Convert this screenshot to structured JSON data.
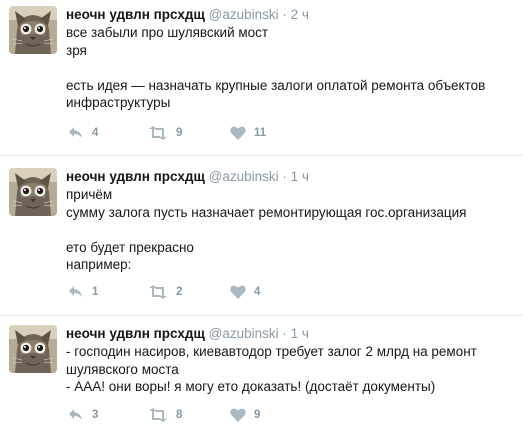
{
  "tweets": [
    {
      "author_name": "неочн удвлн прсхдщ",
      "handle": "@azubinski",
      "separator": "·",
      "time": "2 ч",
      "lines": [
        "все забыли про шулявский мост",
        "зря",
        "",
        "есть идея — назначать крупные залоги оплатой ремонта объектов",
        "инфраструктуры"
      ],
      "reply_count": "4",
      "retweet_count": "9",
      "like_count": "11"
    },
    {
      "author_name": "неочн удвлн прсхдщ",
      "handle": "@azubinski",
      "separator": "·",
      "time": "1 ч",
      "lines": [
        "причём",
        "сумму залога пусть назначает ремонтирующая гос.организация",
        "",
        "ето будет прекрасно",
        "например:"
      ],
      "reply_count": "1",
      "retweet_count": "2",
      "like_count": "4"
    },
    {
      "author_name": "неочн удвлн прсхдщ",
      "handle": "@azubinski",
      "separator": "·",
      "time": "1 ч",
      "lines": [
        "- господин насиров, киевавтодор требует залог 2 млрд на ремонт",
        "шулявского моста",
        "- ААА! они воры! я могу ето доказать! (достаёт документы)"
      ],
      "reply_count": "3",
      "retweet_count": "8",
      "like_count": "9"
    }
  ],
  "colors": {
    "text": "#14171a",
    "muted": "#8899a6",
    "divider": "#e1e8ed"
  },
  "icons": {
    "avatar": "cat-photo",
    "reply": "reply-arrow-icon",
    "retweet": "retweet-icon",
    "like": "heart-icon"
  }
}
